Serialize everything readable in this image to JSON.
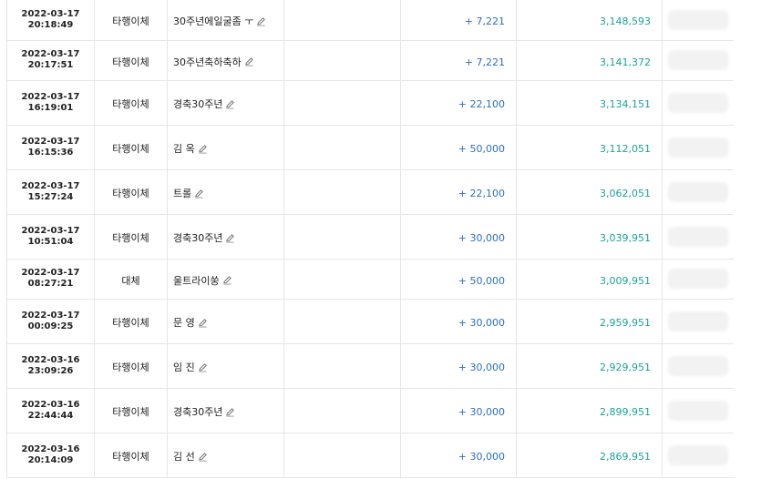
{
  "transactions": [
    {
      "date": "2022-03-17",
      "time": "20:18:49",
      "type": "타행이체",
      "memo": "30주년에일굴좀 ㅜ",
      "amount": "+ 7,221",
      "balance": "3,148,593"
    },
    {
      "date": "2022-03-17",
      "time": "20:17:51",
      "type": "타행이체",
      "memo": "30주년축하축하",
      "amount": "+ 7,221",
      "balance": "3,141,372"
    },
    {
      "date": "2022-03-17",
      "time": "16:19:01",
      "type": "타행이체",
      "memo": "경축30주년",
      "amount": "+ 22,100",
      "balance": "3,134,151"
    },
    {
      "date": "2022-03-17",
      "time": "16:15:36",
      "type": "타행이체",
      "memo": "김 옥",
      "amount": "+ 50,000",
      "balance": "3,112,051"
    },
    {
      "date": "2022-03-17",
      "time": "15:27:24",
      "type": "타행이체",
      "memo": "트롤",
      "amount": "+ 22,100",
      "balance": "3,062,051"
    },
    {
      "date": "2022-03-17",
      "time": "10:51:04",
      "type": "타행이체",
      "memo": "경축30주년",
      "amount": "+ 30,000",
      "balance": "3,039,951"
    },
    {
      "date": "2022-03-17",
      "time": "08:27:21",
      "type": "대체",
      "memo": "울트라이쑹",
      "amount": "+ 50,000",
      "balance": "3,009,951"
    },
    {
      "date": "2022-03-17",
      "time": "00:09:25",
      "type": "타행이체",
      "memo": "문 영",
      "amount": "+ 30,000",
      "balance": "2,959,951"
    },
    {
      "date": "2022-03-16",
      "time": "23:09:26",
      "type": "타행이체",
      "memo": "임 진",
      "amount": "+ 30,000",
      "balance": "2,929,951"
    },
    {
      "date": "2022-03-16",
      "time": "22:44:44",
      "type": "타행이체",
      "memo": "경축30주년",
      "amount": "+ 30,000",
      "balance": "2,899,951"
    },
    {
      "date": "2022-03-16",
      "time": "20:14:09",
      "type": "타행이체",
      "memo": "김 선",
      "amount": "+ 30,000",
      "balance": "2,869,951"
    }
  ],
  "colors": {
    "amount": "#2b6fc2",
    "balance": "#1aa39a",
    "border": "#e6e6e6",
    "text": "#222222"
  },
  "icons": {
    "edit": "pencil-icon"
  }
}
